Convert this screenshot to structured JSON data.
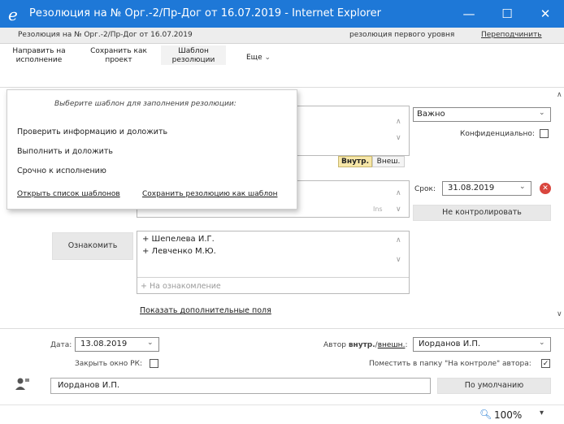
{
  "window": {
    "title": "Резолюция на № Орг.-2/Пр-Дог от 16.07.2019 - Internet Explorer",
    "ie_glyph": "e",
    "minimize": "—",
    "maximize": "☐",
    "close": "✕"
  },
  "infobar": {
    "doc_title": "Резолюция на № Орг.-2/Пр-Дог от 16.07.2019",
    "level": "резолюция первого уровня",
    "resubmit": "Переподчинить"
  },
  "toolbar": {
    "send_line1": "Направить на",
    "send_line2": "исполнение",
    "save_line1": "Сохранить как",
    "save_line2": "проект",
    "template_line1": "Шаблон",
    "template_line2": "резолюции",
    "more": "Еще"
  },
  "menu": {
    "hint": "Выберите шаблон для заполнения резолюции:",
    "items": [
      "Проверить информацию и доложить",
      "Выполнить и доложить",
      "Срочно к исполнению"
    ],
    "open_list": "Открыть список шаблонов",
    "save_as": "Сохранить резолюцию как шаблон"
  },
  "form": {
    "priority_value": "Важно",
    "confidential_label": "Конфиденциально:",
    "inner_button": "Внутр.",
    "outer_button": "Внеш.",
    "ins_label": "Ins",
    "deadline_label": "Срок:",
    "deadline_value": "31.08.2019",
    "no_control_button": "Не контролировать",
    "acquaint_button": "Ознакомить",
    "acquaint_list": [
      "+ Шепелева И.Г.",
      "+ Левченко М.Ю."
    ],
    "add_acquaint_placeholder": "+ На ознакомление",
    "show_more_fields": "Показать дополнительные поля",
    "date_label": "Дата:",
    "date_value": "13.08.2019",
    "close_window_label": "Закрыть окно РК:",
    "author_prefix": "Автор",
    "author_inner": "внутр.",
    "author_sep": "/",
    "author_outer": "внешн.",
    "author_colon": ":",
    "author_value": "Иорданов И.П.",
    "control_folder_label": "Поместить в папку \"На контроле\" автора:",
    "control_folder_check": "✓",
    "signer_value": "Иорданов И.П.",
    "default_button": "По умолчанию"
  },
  "status": {
    "zoom": "100%"
  },
  "colors": {
    "titlebar": "#1e78d7",
    "delete_icon": "#d9463e",
    "inner_button": "#f7e7a8"
  }
}
